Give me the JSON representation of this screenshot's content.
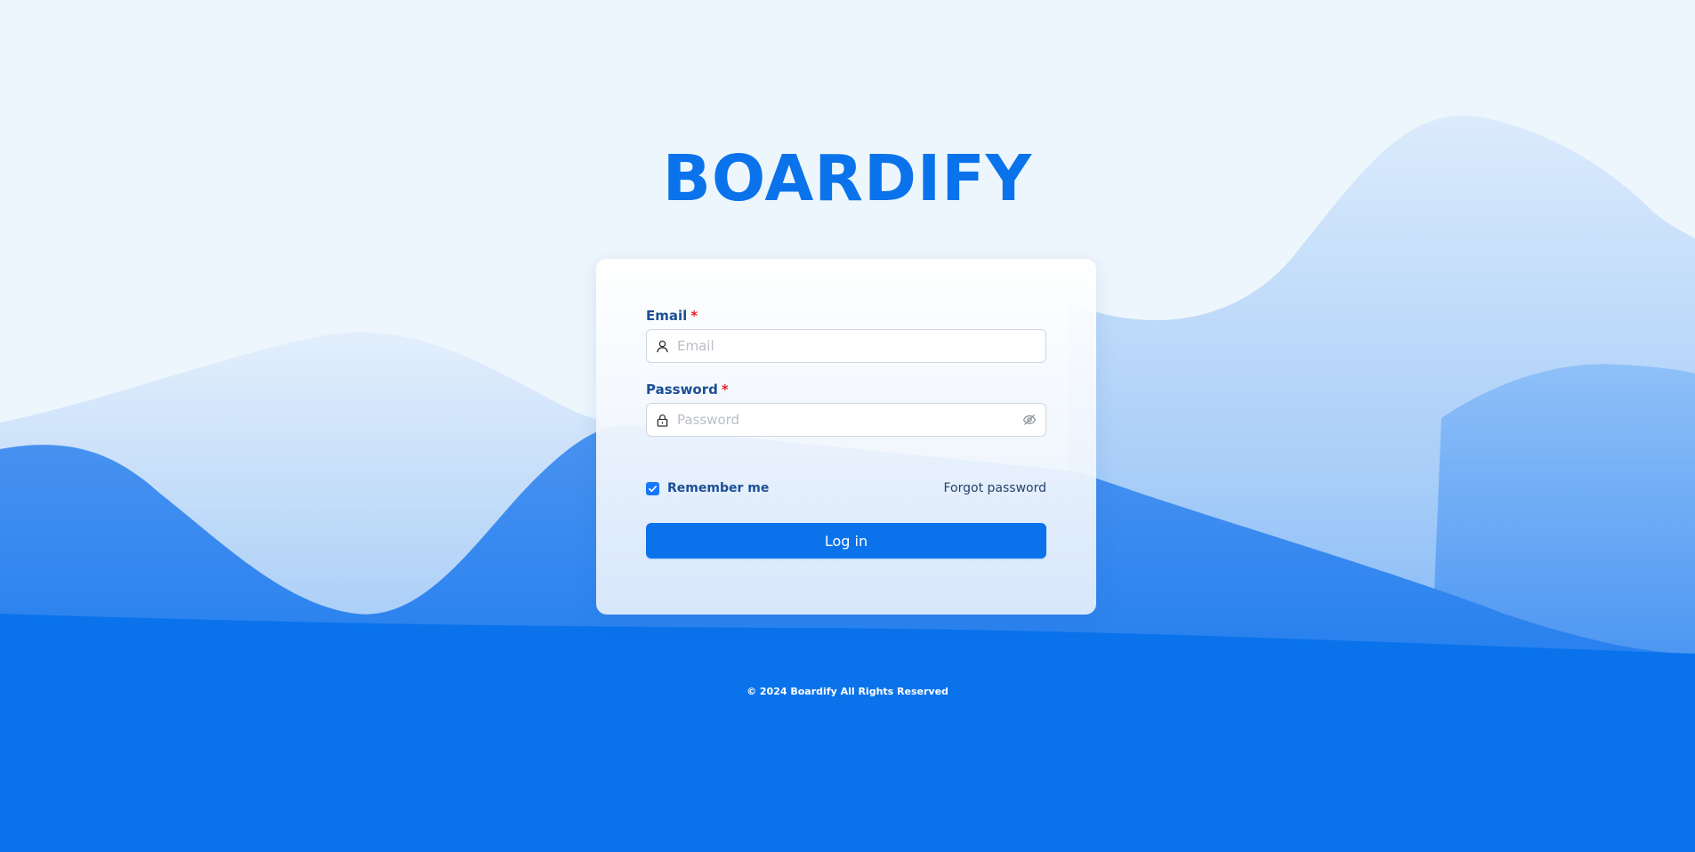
{
  "brand": {
    "name": "BOARDIFY",
    "color": "#0a73eb"
  },
  "form": {
    "email": {
      "label": "Email",
      "required_mark": "*",
      "placeholder": "Email",
      "value": "",
      "icon": "user-icon"
    },
    "password": {
      "label": "Password",
      "required_mark": "*",
      "placeholder": "Password",
      "value": "",
      "icon": "lock-icon",
      "toggle_icon": "eye-invisible-icon"
    },
    "remember": {
      "label": "Remember me",
      "checked": true
    },
    "forgot_label": "Forgot password",
    "submit_label": "Log in"
  },
  "footer": {
    "text": "© 2024 Boardify All Rights Reserved"
  },
  "colors": {
    "background_light": "#eef6fd",
    "background_blue": "#0a73eb",
    "label_text": "#1b4f94",
    "required": "#e5202c"
  }
}
